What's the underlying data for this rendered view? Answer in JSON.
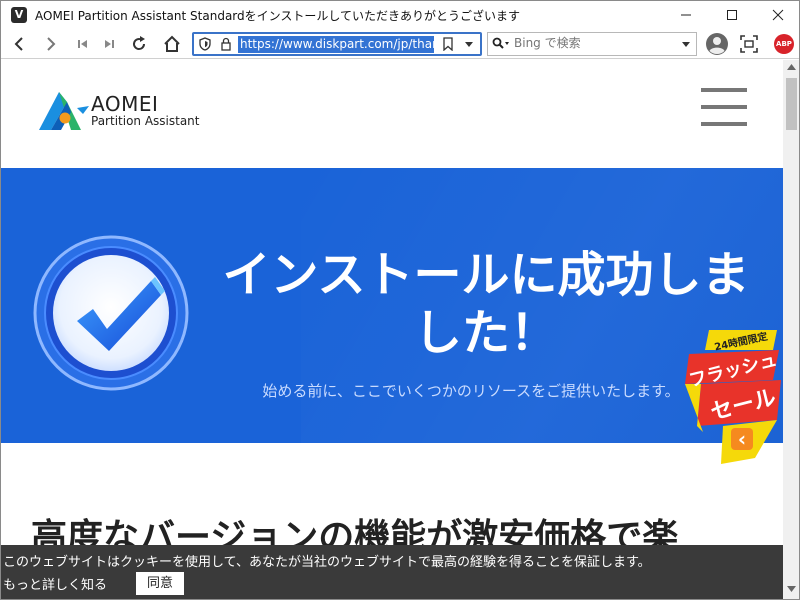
{
  "window": {
    "title": "AOMEI Partition Assistant Standardをインストールしていただきありがとうございます",
    "app_icon_letter": "V"
  },
  "toolbar": {
    "url": "https://www.diskpart.com/jp/than",
    "search_placeholder": "Bing で検索",
    "abp_label": "ABP"
  },
  "site": {
    "logo_name": "AOMEI",
    "logo_sub": "Partition Assistant"
  },
  "hero": {
    "title": "インストールに成功しました！",
    "subtitle": "始める前に、ここでいくつかのリソースをご提供いたします。"
  },
  "sale": {
    "tag": "24時間限定",
    "line1": "フラッシュ",
    "line2": "セール",
    "arrow": "‹"
  },
  "section": {
    "title": "高度なバージョンの機能が激安価格で楽"
  },
  "cookie": {
    "message": "このウェブサイトはクッキーを使用して、あなたが当社のウェブサイトで最高の経験を得ることを保証します。",
    "more_link": "もっと詳しく知る",
    "agree_label": "同意"
  },
  "colors": {
    "hero_blue": "#1a63d8",
    "url_highlight": "#3373d4",
    "cookie_bg": "#3a3a3a",
    "sale_yellow": "#f5d90a",
    "sale_red": "#e8332a"
  }
}
